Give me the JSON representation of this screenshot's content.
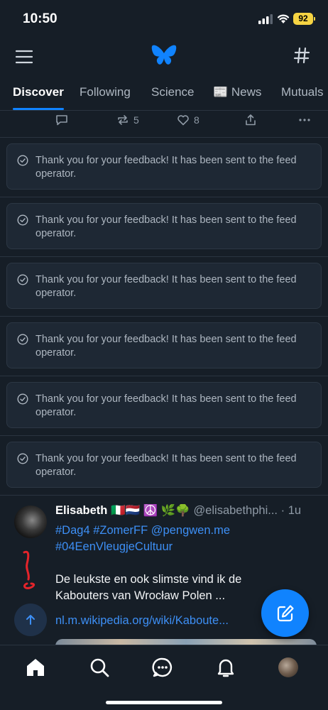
{
  "status_bar": {
    "time": "10:50",
    "battery": "92"
  },
  "tabs": [
    {
      "label": "Discover",
      "active": true
    },
    {
      "label": "Following"
    },
    {
      "label": "Science"
    },
    {
      "label": "📰 News"
    },
    {
      "label": "Mutuals"
    }
  ],
  "actions": {
    "reposts": "5",
    "likes": "8"
  },
  "feedback_message": "Thank you for your feedback! It has been sent to the feed operator.",
  "feedback_items": [
    "Thank you for your feedback! It has been sent to the feed operator.",
    "Thank you for your feedback! It has been sent to the feed operator.",
    "Thank you for your feedback! It has been sent to the feed operator.",
    "Thank you for your feedback! It has been sent to the feed operator.",
    "Thank you for your feedback! It has been sent to the feed operator.",
    "Thank you for your feedback! It has been sent to the feed operator."
  ],
  "post": {
    "author_name": "Elisabeth 🇮🇹🇳🇱 ☮️ 🌿🌳",
    "handle": "@elisabethphi...",
    "time": "· 1u",
    "tags_line1": "#Dag4 #ZomerFF @pengwen.me",
    "tags_line2": "#04EenVleugjeCultuur",
    "text": "De leukste en ook slimste vind ik de Kabouters van Wrocław Polen ...",
    "link": "nl.m.wikipedia.org/wiki/Kaboute..."
  },
  "colors": {
    "accent": "#1083fe",
    "background": "#161e27",
    "card": "#1e2834",
    "link": "#3d8ff5"
  },
  "icons": {
    "header": [
      "menu-icon",
      "butterfly-logo-icon",
      "hash-icon"
    ],
    "actions": [
      "reply-icon",
      "repost-icon",
      "like-icon",
      "share-icon",
      "more-icon"
    ],
    "nav": [
      "home-icon",
      "search-icon",
      "chat-icon",
      "bell-icon",
      "profile-avatar"
    ]
  }
}
